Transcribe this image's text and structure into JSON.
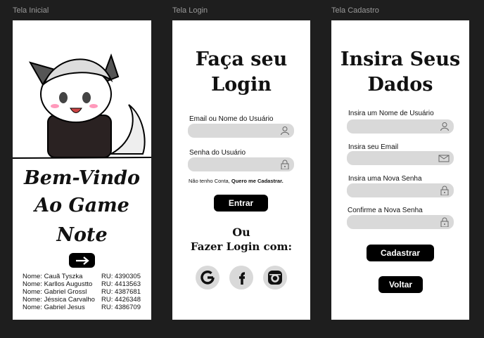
{
  "frames": {
    "home": "Tela Inicial",
    "login": "Tela Login",
    "signup": "Tela Cadastro"
  },
  "home": {
    "title_lines": [
      "Bem-Vindo",
      "Ao Game",
      "Note"
    ],
    "members": [
      {
        "name": "Nome: Cauã Tyszka",
        "ru": "RU: 4390305"
      },
      {
        "name": "Nome: Karllos Augustto",
        "ru": "RU: 4413563"
      },
      {
        "name": "Nome: Gabriel Grossl",
        "ru": "RU: 4387681"
      },
      {
        "name": "Nome: Jéssica Carvalho",
        "ru": "RU: 4426348"
      },
      {
        "name": "Nome: Gabriel Jesus",
        "ru": "RU: 4386709"
      }
    ]
  },
  "login": {
    "title_lines": [
      "Faça seu",
      "Login"
    ],
    "user_label": "Email ou Nome do Usuário",
    "pass_label": "Senha do Usuário",
    "no_account": "Não tenho Conta, ",
    "register_link": "Quero me Cadastrar.",
    "enter": "Entrar",
    "or": "Ou",
    "social_label": "Fazer Login com:"
  },
  "signup": {
    "title_lines": [
      "Insira Seus",
      "Dados"
    ],
    "name_label": "Insira um Nome de Usuário",
    "email_label": "Insira seu Email",
    "pass_label": "Insira uma Nova Senha",
    "confirm_label": "Confirme a Nova Senha",
    "register": "Cadastrar",
    "back": "Voltar"
  }
}
